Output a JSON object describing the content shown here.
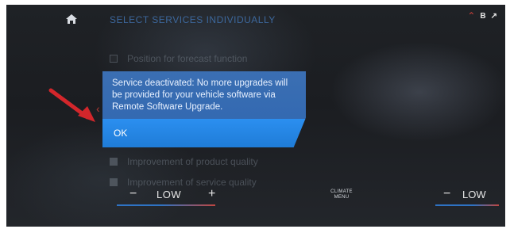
{
  "header": {
    "title": "SELECT SERVICES INDIVIDUALLY",
    "icons": {
      "home": "home-icon",
      "top_right": [
        "red-chevron-icon",
        "b-icon",
        "small-arrow-icon"
      ]
    },
    "colors": {
      "title": "#3f6ea8"
    }
  },
  "services_list": {
    "items": [
      {
        "label": "Position for forecast function",
        "checked": false
      },
      {
        "label": "Improvement of product quality",
        "checked": true
      },
      {
        "label": "Improvement of service quality",
        "checked": true
      }
    ]
  },
  "dialog": {
    "message": "Service deactivated: No more upgrades will be provided for your vehicle software via Remote Software Upgrade.",
    "ok_label": "OK",
    "colors": {
      "background": "#2f66b0",
      "ok_background": "#1f7cd7"
    }
  },
  "climate": {
    "left": {
      "minus": "−",
      "temp": "LOW",
      "plus": "+"
    },
    "menu_label": "CLIMATE MENU",
    "right": {
      "minus": "−",
      "temp": "LOW"
    }
  },
  "annotation": {
    "arrow_color": "#d3262b"
  }
}
